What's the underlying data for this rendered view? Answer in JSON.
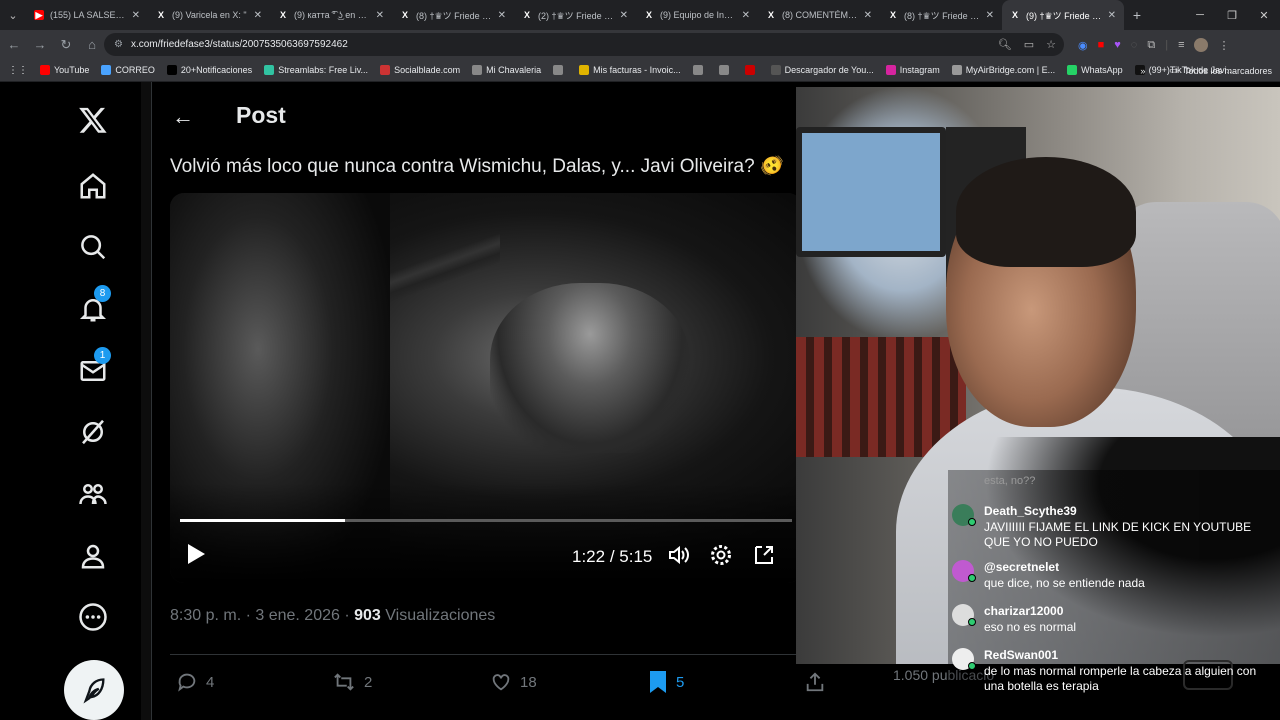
{
  "browser": {
    "tabs": [
      {
        "label": "(155) LA SALSERÍA TI",
        "fav": "▶",
        "color": "#ff0000"
      },
      {
        "label": "(9) Varicela en X: \"",
        "fav": "X",
        "color": "#000"
      },
      {
        "label": "(9) катта ͡° ͜ʖ en X: \"A",
        "fav": "X",
        "color": "#000"
      },
      {
        "label": "(8) †♛ツ Friede ❁◕",
        "fav": "X",
        "color": "#000"
      },
      {
        "label": "(2) †♛ツ Friede ❁◕",
        "fav": "X",
        "color": "#000"
      },
      {
        "label": "(9) Equipo de Investi",
        "fav": "X",
        "color": "#000"
      },
      {
        "label": "(8) COMENTÉMOSLO",
        "fav": "X",
        "color": "#000"
      },
      {
        "label": "(8) †♛ツ Friede ❁◕",
        "fav": "X",
        "color": "#000"
      },
      {
        "label": "(9) †♛ツ Friede ❁◕",
        "fav": "X",
        "color": "#000",
        "active": true
      }
    ],
    "url": "x.com/friedefase3/status/2007535063697592462",
    "bookmarks": [
      {
        "label": "YouTube",
        "color": "#ff0000"
      },
      {
        "label": "CORREO",
        "color": "#4aa3ff"
      },
      {
        "label": "20+Notificaciones",
        "color": "#000"
      },
      {
        "label": "Streamlabs: Free Liv...",
        "color": "#31c3a2"
      },
      {
        "label": "Socialblade.com",
        "color": "#c33"
      },
      {
        "label": "Mi Chavaleria",
        "color": "#888"
      },
      {
        "label": "",
        "color": "#888"
      },
      {
        "label": "Mis facturas - Invoic...",
        "color": "#e0b400"
      },
      {
        "label": "",
        "color": "#888"
      },
      {
        "label": "",
        "color": "#888"
      },
      {
        "label": "",
        "color": "#c00"
      },
      {
        "label": "Descargador de You...",
        "color": "#555"
      },
      {
        "label": "Instagram",
        "color": "#d6249f"
      },
      {
        "label": "MyAirBridge.com | E...",
        "color": "#999"
      },
      {
        "label": "WhatsApp",
        "color": "#25d366"
      },
      {
        "label": "(99+)TikTok de Javi...",
        "color": "#111"
      }
    ],
    "bookmarks_all": "Todos los marcadores"
  },
  "sidebar": {
    "notifications_badge": "8",
    "messages_badge": "1"
  },
  "post": {
    "header_title": "Post",
    "text": "Volvió más loco que nunca contra Wismichu, Dalas, y... Javi Oliveira? 🫨",
    "video": {
      "current_time": "1:22",
      "separator": "/",
      "duration": "5:15",
      "progress": 0.27
    },
    "time": "8:30 p. m.",
    "date": "3 ene. 2026",
    "views_count": "903",
    "views_label": "Visualizaciones",
    "replies": "4",
    "reposts": "2",
    "likes": "18",
    "bookmarks": "5"
  },
  "right_column": {
    "posts_count": "1.050 publicacio"
  },
  "stream_chat": {
    "faded": "esta, no??",
    "messages": [
      {
        "user": "Death_Scythe39",
        "text": "JAVIIIIII FIJAME EL LINK DE KICK EN YOUTUBE QUE YO NO PUEDO",
        "avatar_color": "#3a7d5a"
      },
      {
        "user": "@secretnelet",
        "text": "que dice, no se entiende nada",
        "avatar_color": "#c05ad0"
      },
      {
        "user": "charizar12000",
        "text": "eso no es normal",
        "avatar_color": "#dddddd"
      },
      {
        "user": "RedSwan001",
        "text": "de lo mas normal romperle la cabeza a alguien con una botella es terapia",
        "avatar_color": "#eeeeee"
      }
    ]
  }
}
